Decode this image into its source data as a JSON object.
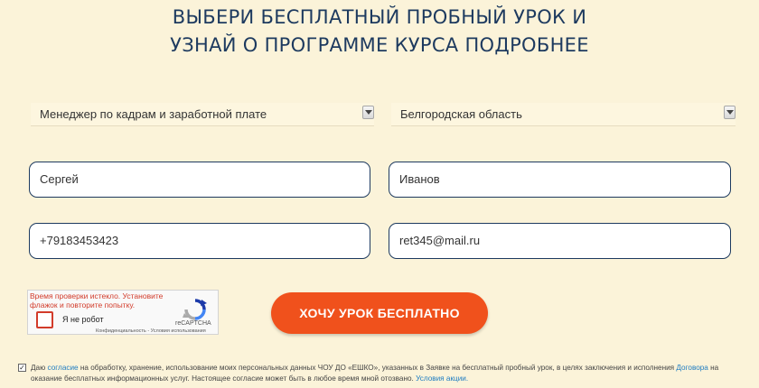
{
  "heading": {
    "line1": "ВЫБЕРИ БЕСПЛАТНЫЙ ПРОБНЫЙ УРОК И",
    "line2": "УЗНАЙ О ПРОГРАММЕ КУРСА ПОДРОБНЕЕ"
  },
  "form": {
    "course_select": "Менеджер по кадрам и заработной плате",
    "region_select": "Белгородская область",
    "first_name": "Сергей",
    "last_name": "Иванов",
    "phone": "+79183453423",
    "email": "ret345@mail.ru",
    "submit_label": "ХОЧУ УРОК БЕСПЛАТНО"
  },
  "captcha": {
    "error": "Время проверки истекло. Установите флажок и повторите попытку.",
    "label": "Я не робот",
    "brand": "reCAPTCHA",
    "links": "Конфиденциальность - Условия использования"
  },
  "consent": {
    "checked": true,
    "t1": "Даю ",
    "link1": "согласие",
    "t2": " на обработку, хранение, использование моих персональных данных ЧОУ ДО «ЕШКО», указанных в Заявке на бесплатный пробный урок, в целях заключения и исполнения ",
    "link2": "Договора",
    "t3": " на оказание бесплатных информационных услуг. Настоящее согласие может быть в любое время мной отозвано. ",
    "link3": "Условия акции."
  },
  "colors": {
    "background": "#fbf3d9",
    "heading": "#1d3a5f",
    "cta": "#f0511c",
    "link": "#1f7dc2"
  }
}
